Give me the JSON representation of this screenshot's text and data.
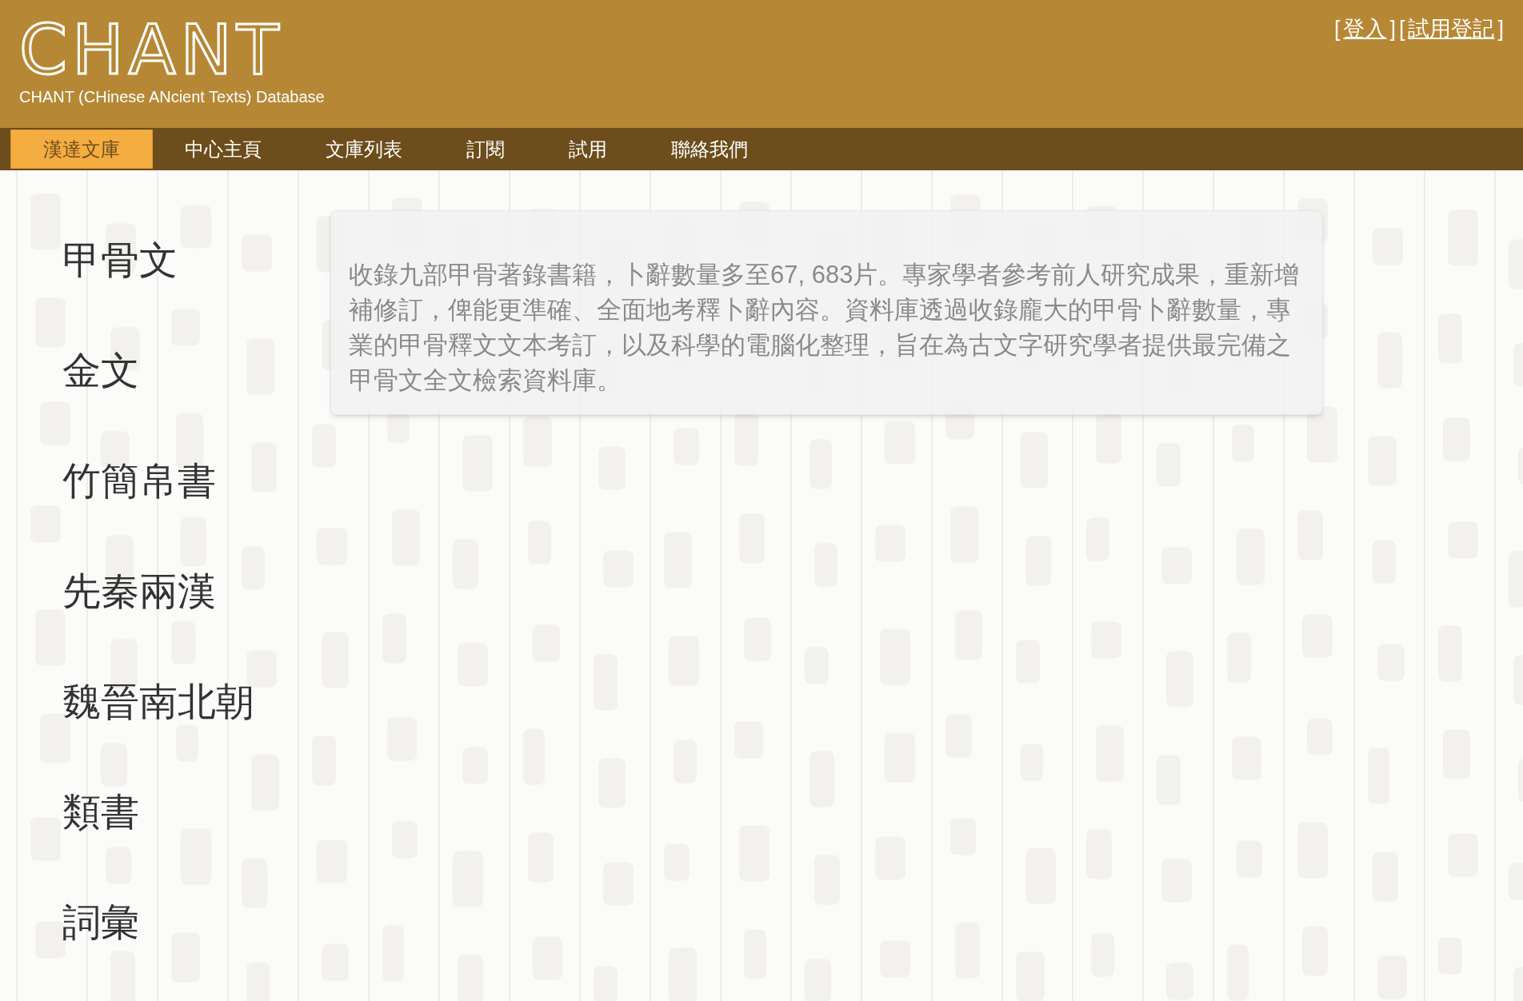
{
  "header": {
    "logo": "CHANT",
    "subtitle": "CHANT (CHinese ANcient Texts) Database",
    "account_links": [
      {
        "kind": "bracket",
        "text": "["
      },
      {
        "kind": "link",
        "text": "登入"
      },
      {
        "kind": "bracket",
        "text": "]"
      },
      {
        "kind": "bracket",
        "text": "["
      },
      {
        "kind": "link",
        "text": "試用登記"
      },
      {
        "kind": "bracket",
        "text": "]"
      }
    ]
  },
  "nav": [
    {
      "label": "漢達文庫",
      "selected": true
    },
    {
      "label": "中心主頁",
      "selected": false
    },
    {
      "label": "文庫列表",
      "selected": false
    },
    {
      "label": "訂閱",
      "selected": false
    },
    {
      "label": "試用",
      "selected": false
    },
    {
      "label": "聯絡我們",
      "selected": false
    }
  ],
  "sidebar": {
    "items": [
      "甲骨文",
      "金文",
      "竹簡帛書",
      "先秦兩漢",
      "魏晉南北朝",
      "類書",
      "詞彙"
    ]
  },
  "description": "收錄九部甲骨著錄書籍，卜辭數量多至67, 683片。專家學者參考前人研究成果，重新增補修訂，俾能更準確、全面地考釋卜辭內容。資料庫透過收錄龐大的甲骨卜辭數量，專業的甲骨釋文文本考訂，以及科學的電腦化整理，旨在為古文字研究學者提供最完備之甲骨文全文檢索資料庫。"
}
